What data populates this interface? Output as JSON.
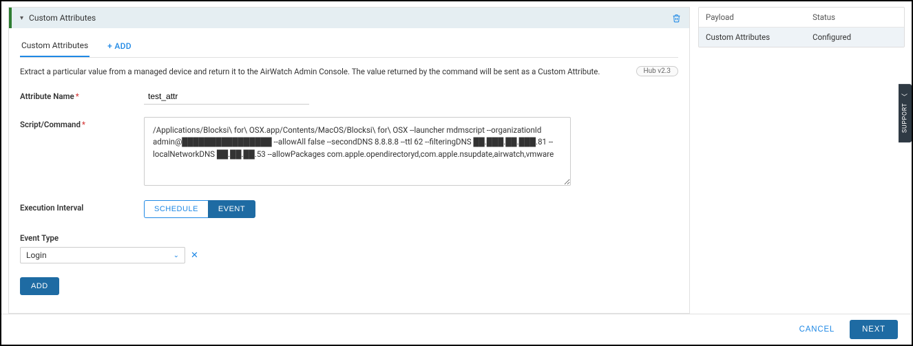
{
  "section": {
    "title": "Custom Attributes"
  },
  "tabs": {
    "main": "Custom Attributes",
    "add": "+ ADD"
  },
  "description": "Extract a particular value from a managed device and return it to the AirWatch Admin Console. The value returned by the command will be sent as a Custom Attribute.",
  "hubBadge": "Hub v2.3",
  "fields": {
    "attributeName": {
      "label": "Attribute Name",
      "value": "test_attr"
    },
    "scriptCommand": {
      "label": "Script/Command",
      "value": "/Applications/Blocksi\\ for\\ OSX.app/Contents/MacOS/Blocksi\\ for\\ OSX --launcher mdmscript --organizationId admin@████████████████ --allowAll false --secondDNS 8.8.8.8 --ttl 62 --filteringDNS ██.███.██.███.81 --localNetworkDNS ██.██.██.53 --allowPackages com.apple.opendirectoryd,com.apple.nsupdate,airwatch,vmware"
    },
    "executionInterval": {
      "label": "Execution Interval",
      "options": {
        "schedule": "SCHEDULE",
        "event": "EVENT"
      },
      "active": "event"
    },
    "eventType": {
      "label": "Event Type",
      "value": "Login"
    }
  },
  "buttons": {
    "add": "ADD",
    "cancel": "CANCEL",
    "next": "NEXT"
  },
  "sideTable": {
    "header": {
      "payload": "Payload",
      "status": "Status"
    },
    "row": {
      "payload": "Custom Attributes",
      "status": "Configured"
    }
  },
  "support": "SUPPORT"
}
